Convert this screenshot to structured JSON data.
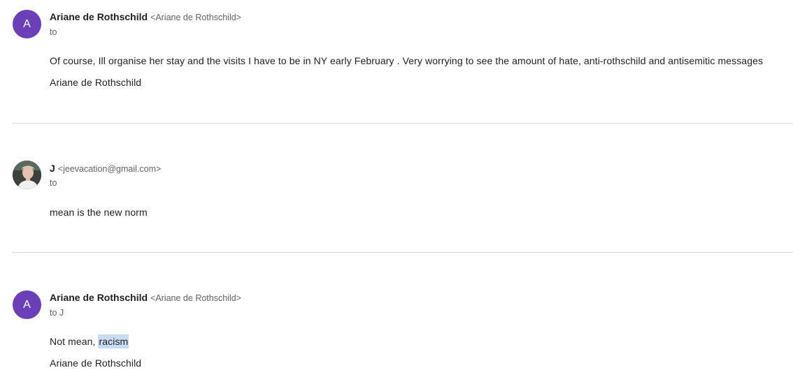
{
  "messages": [
    {
      "avatar_letter": "A",
      "sender_name": "Ariane de Rothschild",
      "sender_email": "<Ariane de Rothschild>",
      "to": "to",
      "body": "Of course, Ill organise her stay and the visits I have to be in NY early February . Very worrying to see the amount of hate, anti-rothschild and antisemitic messages",
      "signature": "Ariane de Rothschild"
    },
    {
      "avatar_icon": "person-photo-icon",
      "sender_name": "J",
      "sender_email": "<jeevacation@gmail.com>",
      "to": "to",
      "body": "mean is the new norm"
    },
    {
      "avatar_letter": "A",
      "sender_name": "Ariane de Rothschild",
      "sender_email": "<Ariane de Rothschild>",
      "to": "to J",
      "body_prefix": "Not mean, ",
      "body_highlight": "racism",
      "signature": "Ariane de Rothschild"
    }
  ],
  "colors": {
    "avatar_purple": "#6b3fb8",
    "highlight": "#c8dcf3",
    "divider": "#dadce0"
  }
}
